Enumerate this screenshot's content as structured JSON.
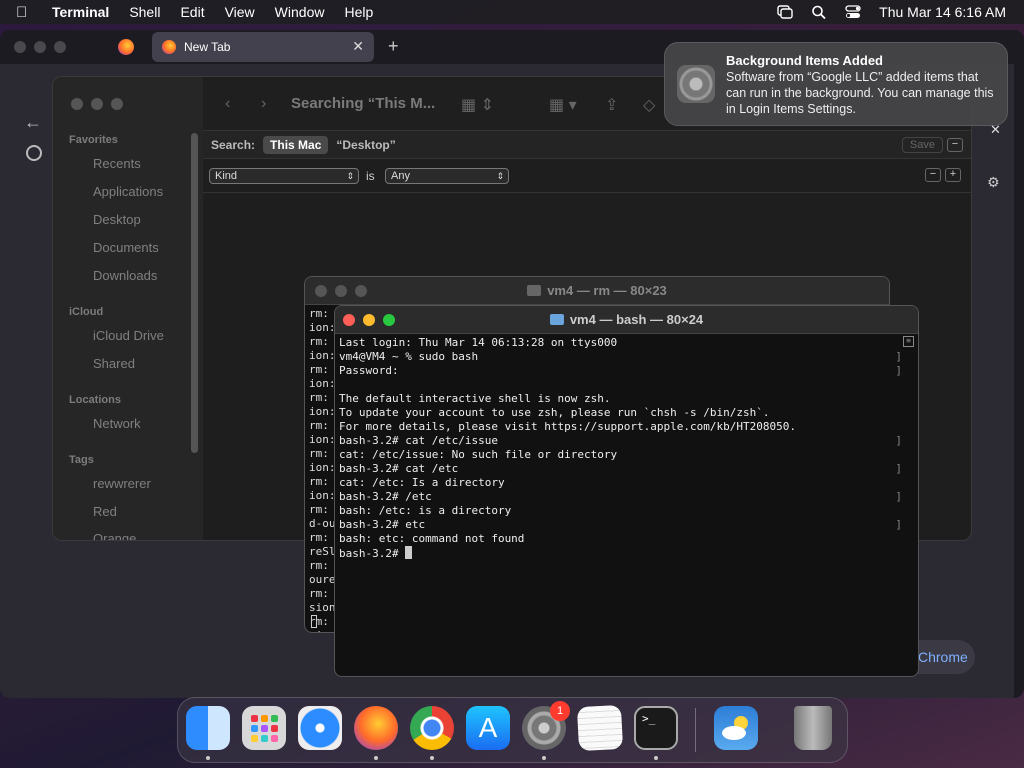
{
  "menubar": {
    "app": "Terminal",
    "items": [
      "Shell",
      "Edit",
      "View",
      "Window",
      "Help"
    ],
    "clock": "Thu Mar 14  6:16 AM"
  },
  "browser": {
    "tab_title": "New Tab",
    "chrome_button": "Chrome"
  },
  "finder": {
    "title": "Searching “This M...",
    "sidebar": {
      "favorites_label": "Favorites",
      "favorites": [
        "Recents",
        "Applications",
        "Desktop",
        "Documents",
        "Downloads"
      ],
      "icloud_label": "iCloud",
      "icloud": [
        "iCloud Drive",
        "Shared"
      ],
      "locations_label": "Locations",
      "locations": [
        "Network"
      ],
      "tags_label": "Tags",
      "tags": [
        "rewwrerer",
        "Red",
        "Orange"
      ]
    },
    "search_label": "Search:",
    "scope_selected": "This Mac",
    "scope_other": "“Desktop”",
    "save_label": "Save",
    "criteria_attr": "Kind",
    "criteria_is": "is",
    "criteria_value": "Any"
  },
  "terminal_back": {
    "title": "vm4 — rm — 80×23",
    "lines": [
      "rm:",
      "ion:",
      "rm:",
      "ion:",
      "rm:",
      "ion:",
      "rm:",
      "ion:",
      "rm:",
      "ion:",
      "rm:",
      "ion:",
      "rm:",
      "ion:",
      "rm:",
      "d-ou",
      "rm:",
      "reSl",
      "rm:",
      "oure",
      "rm:",
      "sion",
      "rm:",
      "sion"
    ]
  },
  "terminal_front": {
    "title": "vm4 — bash — 80×24",
    "lines": [
      "Last login: Thu Mar 14 06:13:28 on ttys000",
      "vm4@VM4 ~ % sudo bash",
      "Password:",
      "",
      "The default interactive shell is now zsh.",
      "To update your account to use zsh, please run `chsh -s /bin/zsh`.",
      "For more details, please visit https://support.apple.com/kb/HT208050.",
      "bash-3.2# cat /etc/issue",
      "cat: /etc/issue: No such file or directory",
      "bash-3.2# cat /etc",
      "cat: /etc: Is a directory",
      "bash-3.2# /etc",
      "bash: /etc: is a directory",
      "bash-3.2# etc",
      "bash: etc: command not found"
    ],
    "prompt": "bash-3.2# "
  },
  "notification": {
    "title": "Background Items Added",
    "body": "Software from “Google LLC” added items that can run in the background. You can manage this in Login Items Settings."
  },
  "dock": {
    "settings_badge": "1",
    "apps": [
      "finder-icon",
      "launchpad-icon",
      "safari-icon",
      "firefox-icon",
      "chrome-icon",
      "app-store-icon",
      "system-settings-icon",
      "textedit-icon",
      "terminal-icon",
      "weather-icon",
      "trash-icon"
    ]
  }
}
